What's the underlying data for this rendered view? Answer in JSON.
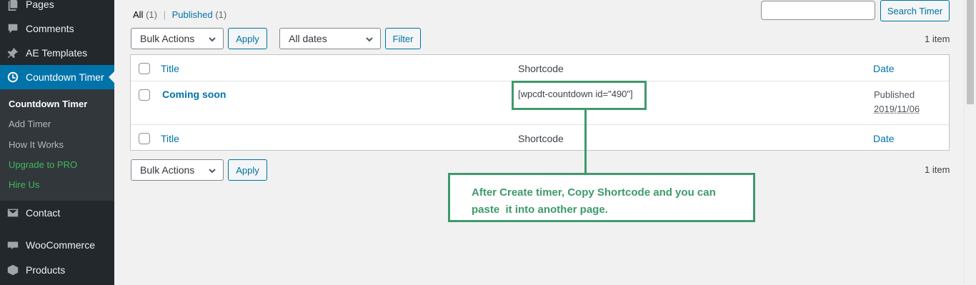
{
  "sidebar": {
    "items": [
      {
        "label": "Pages",
        "icon": "pages-icon"
      },
      {
        "label": "Comments",
        "icon": "comments-icon"
      },
      {
        "label": "AE Templates",
        "icon": "pin-icon"
      },
      {
        "label": "Countdown Timer",
        "icon": "clock-icon"
      },
      {
        "label": "Contact",
        "icon": "mail-icon"
      },
      {
        "label": "WooCommerce",
        "icon": "woo-icon"
      },
      {
        "label": "Products",
        "icon": "box-icon"
      }
    ],
    "submenu": [
      {
        "label": "Countdown Timer"
      },
      {
        "label": "Add Timer"
      },
      {
        "label": "How It Works"
      },
      {
        "label": "Upgrade to PRO"
      },
      {
        "label": "Hire Us"
      }
    ]
  },
  "views": {
    "all_label": "All",
    "all_count": "(1)",
    "published_label": "Published",
    "published_count": "(1)"
  },
  "search": {
    "value": "",
    "button": "Search Timer"
  },
  "top_nav": {
    "bulk_actions": "Bulk Actions",
    "apply": "Apply",
    "dates": "All dates",
    "filter": "Filter",
    "count": "1 item"
  },
  "table": {
    "columns": {
      "title": "Title",
      "shortcode": "Shortcode",
      "date": "Date"
    },
    "rows": [
      {
        "title": "Coming soon",
        "shortcode": "[wpcdt-countdown id=\"490\"]",
        "status": "Published",
        "date": "2019/11/06"
      }
    ]
  },
  "bottom_nav": {
    "bulk_actions": "Bulk Actions",
    "apply": "Apply",
    "count": "1 item"
  },
  "annotation": {
    "line1": "After Create timer, Copy Shortcode and you can",
    "line2": "paste  it into another page.",
    "color": "#3e9a6b"
  }
}
